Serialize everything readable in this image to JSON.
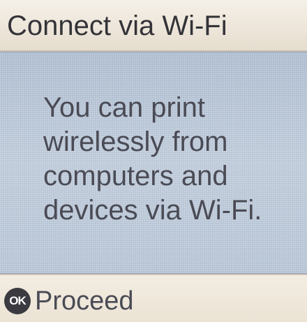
{
  "header": {
    "title": "Connect via Wi-Fi"
  },
  "main": {
    "message": "You can print\nwirelessly from\ncomputers and\ndevices via Wi-Fi."
  },
  "footer": {
    "ok_icon_label": "OK",
    "proceed_label": "Proceed"
  }
}
